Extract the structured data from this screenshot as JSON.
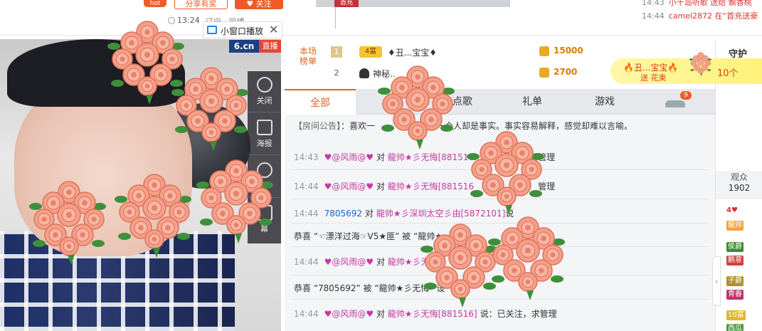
{
  "top": {
    "hot_badge": "hot",
    "share_label": "分享有奖",
    "follow_label": "关注",
    "time": "13:24",
    "location": "辽宁 · 丽博",
    "first_flag": "首充"
  },
  "notices": [
    {
      "time": "14:43",
      "text": "小千岛听歌 送给 飘香桃",
      "color": "#d9352b"
    },
    {
      "time": "14:44",
      "text": "camel2872 在“首充送豪",
      "color": "#d9352b"
    }
  ],
  "mini_window": {
    "label": "小窗口播放",
    "close": "✕",
    "logo": "6.cn",
    "live": "直播"
  },
  "controls": [
    {
      "name": "close-control",
      "label": "关闭"
    },
    {
      "name": "poster-control",
      "label": "海报"
    },
    {
      "name": "share-control",
      "label": ""
    },
    {
      "name": "danmaku-control",
      "label": "幕"
    }
  ],
  "rank": {
    "title": "本场榜单",
    "rows": [
      {
        "num": "1",
        "level": "4富",
        "name": "♦丑...宝宝♦",
        "score": "15000"
      },
      {
        "num": "2",
        "level": "",
        "name": "神秘..",
        "score": "2700"
      }
    ]
  },
  "tabs": [
    {
      "label": "全部",
      "active": true
    },
    {
      "label": "",
      "active": false
    },
    {
      "label": "点歌",
      "active": false
    },
    {
      "label": "礼单",
      "active": false
    },
    {
      "label": "游戏",
      "active": false
    }
  ],
  "car_badge": "9",
  "messages": {
    "announcement_tag": "【房间公告】",
    "announcement": "：喜欢一",
    "announcement_tail": "喜欢一个人却是事实。事实容易解释，感觉却难以言喻。",
    "rows": [
      {
        "time": "14:43",
        "user": "♥@风雨@♥",
        "to": "对",
        "target": "龍帅★彡无悔",
        "id": "[881516",
        "msg": "管理"
      },
      {
        "time": "14:44",
        "user": "♥@风雨@♥",
        "to": "对",
        "target": "龍帅★彡无悔",
        "id": "[881516",
        "msg": "管理"
      },
      {
        "time": "14:44",
        "user": "7805692",
        "to": "对",
        "target": "龍帅★彡深圳太空彡由",
        "id": "[5872101]",
        "msg": "说"
      },
      {
        "time": "",
        "user": "恭喜 “☜漂洋过海☞V5★匪” 被 “龍帅★",
        "to": "",
        "target": "",
        "id": "",
        "msg": "由"
      },
      {
        "time": "14:44",
        "user": "♥@风雨@♥",
        "to": "对",
        "target": "龍帅★彡无悔",
        "id": "",
        "msg": ""
      },
      {
        "time": "",
        "user": "恭喜 “7805692” 被 “龍帅★彡无悔” 设",
        "to": "",
        "target": "",
        "id": "",
        "msg": ""
      },
      {
        "time": "14:44",
        "user": "♥@风雨@♥",
        "to": "对",
        "target": "龍帅★彡无悔",
        "id": "[881516]",
        "msg": "说：已关注，求管理"
      }
    ]
  },
  "right": {
    "guard_label": "守护",
    "audience_label": "观众",
    "audience_count": "1902",
    "heart_count": "4",
    "badges": [
      {
        "text": "龍帅",
        "bg": "#f3a43a"
      },
      {
        "text": "侯爵",
        "bg": "#3d8d2c"
      },
      {
        "text": "鹏意",
        "bg": "#d23f3f"
      },
      {
        "text": "子爵",
        "bg": "#b08f2a"
      },
      {
        "text": "青春",
        "bg": "#c2326b"
      },
      {
        "text": "10富",
        "bg": "#e0b82b"
      },
      {
        "text": "西瓜",
        "bg": "#4a9a3c"
      }
    ]
  },
  "gift_banner": {
    "user": "🔥丑...宝宝🔥",
    "action": "送 花束",
    "count": "10个"
  }
}
